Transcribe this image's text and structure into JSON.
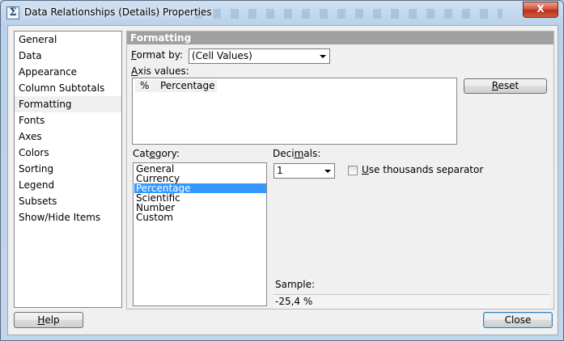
{
  "window": {
    "title": "Data Relationships (Details) Properties",
    "close_glyph": "X"
  },
  "nav": {
    "items": [
      {
        "label": "General"
      },
      {
        "label": "Data"
      },
      {
        "label": "Appearance"
      },
      {
        "label": "Column Subtotals"
      },
      {
        "label": "Formatting",
        "selected": true
      },
      {
        "label": "Fonts"
      },
      {
        "label": "Axes"
      },
      {
        "label": "Colors"
      },
      {
        "label": "Sorting"
      },
      {
        "label": "Legend"
      },
      {
        "label": "Subsets"
      },
      {
        "label": "Show/Hide Items"
      }
    ]
  },
  "panel": {
    "title": "Formatting",
    "format_by_label_mnemonic": "F",
    "format_by_label_rest": "ormat by:",
    "format_by_value": "(Cell Values)",
    "axis_values_label_mnemonic": "A",
    "axis_values_label_rest": "xis values:",
    "axis_values": [
      {
        "symbol": "%",
        "name": "Percentage"
      }
    ],
    "reset_label_mnemonic": "R",
    "reset_label_rest": "eset",
    "category_label_pre": "Cat",
    "category_label_mnemonic": "e",
    "category_label_rest": "gory:",
    "categories": [
      "General",
      "Currency",
      "Percentage",
      "Scientific",
      "Number",
      "Custom"
    ],
    "selected_category": "Percentage",
    "decimals_label_pre": "Deci",
    "decimals_label_mnemonic": "m",
    "decimals_label_rest": "als:",
    "decimals_value": "1",
    "thousands_label_mnemonic": "U",
    "thousands_label_rest": "se thousands separator",
    "thousands_checked": false,
    "sample_label": "Sample:",
    "sample_value": "-25,4 %"
  },
  "footer": {
    "help_label_mnemonic": "H",
    "help_label_rest": "elp",
    "close_label": "Close"
  }
}
